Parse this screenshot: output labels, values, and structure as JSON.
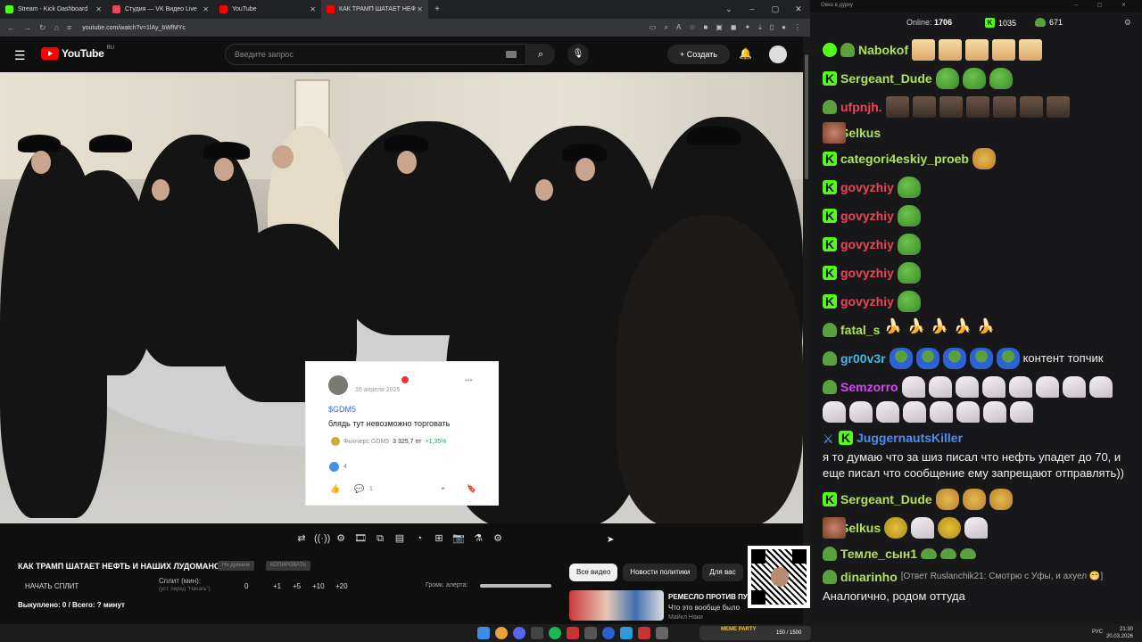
{
  "browser": {
    "tabs": [
      {
        "label": "Stream - Kick Dashboard",
        "color": "#53fc18"
      },
      {
        "label": "Студия — VK Видео Live",
        "color": "#e8465a"
      },
      {
        "label": "YouTube",
        "color": "#ff0000"
      },
      {
        "label": "КАК ТРАМП ШАТАЕТ НЕФ",
        "color": "#ff0000"
      }
    ],
    "url": "youtube.com/watch?v=1lAy_bWfMYc"
  },
  "youtube": {
    "logo": "YouTube",
    "region": "RU",
    "search_placeholder": "Введите запрос",
    "create_label": "Создать"
  },
  "card": {
    "date": "16 апреля 2025",
    "ticker": "$GDM5",
    "message": "блядь тут невозможно торговать",
    "futures_label": "Фьючерс GDM5",
    "futures_price": "3 325,7 пт",
    "futures_change": "+1,35%",
    "likes": "4",
    "comments": "1"
  },
  "below_video": {
    "title": "КАК ТРАМП ШАТАЕТ НЕФТЬ И НАШИХ ЛУДОМАНОВ",
    "pill1": "Не думаем",
    "pill2": "КОПИРОВАТЬ",
    "start_split": "НАЧАТЬ СПЛИТ",
    "split_label": "Сплит (мин):",
    "split_sub": "(уст. перед \"Начать\")",
    "split_value": "0",
    "inc": [
      "+1",
      "+5",
      "+10",
      "+20"
    ],
    "alert_label": "Громк. алерта:",
    "bought": "Выкуплено: 0 / Всего: ? минут",
    "chips": [
      "Все видео",
      "Новости политики",
      "Для вас"
    ],
    "reco_title": "РЕМЕСЛО ПРОТИВ ПУ",
    "reco_subtitle": "Что это вообще было",
    "reco_channel": "Майкл Наки"
  },
  "chat": {
    "window_title": "Окно в дурку",
    "online_label": "Online:",
    "online_count": "1706",
    "kick_count": "1035",
    "peepo_count": "671",
    "messages": [
      {
        "name": "Nabokof",
        "color": "#b2e05a"
      },
      {
        "name": "Sergeant_Dude",
        "color": "#b2e05a"
      },
      {
        "name": "ufpnjh.",
        "color": "#e8465a"
      },
      {
        "name": "Selkus",
        "color": "#b2e05a"
      },
      {
        "name": "categori4eskiy_proeb",
        "color": "#b2e05a"
      },
      {
        "name": "govyzhiy",
        "color": "#e8465a"
      },
      {
        "name": "govyzhiy",
        "color": "#e8465a"
      },
      {
        "name": "govyzhiy",
        "color": "#e8465a"
      },
      {
        "name": "govyzhiy",
        "color": "#e8465a"
      },
      {
        "name": "govyzhiy",
        "color": "#e8465a"
      },
      {
        "name": "fatal_s",
        "color": "#b2e05a"
      },
      {
        "name": "gr00v3r",
        "color": "#49b5e0",
        "text": "контент топчик"
      },
      {
        "name": "Semzorro",
        "color": "#d04cf0"
      },
      {
        "name": "JuggernautsKiller",
        "color": "#4b8cf0",
        "text": "я то думаю что за шиз писал что нефть упадет до 70, и еще писал что сообщение ему запрещают отправлять))"
      },
      {
        "name": "Sergeant_Dude",
        "color": "#b2e05a"
      },
      {
        "name": "Selkus",
        "color": "#b2e05a"
      },
      {
        "name": "Темле_сын1",
        "color": "#b2e05a"
      },
      {
        "name": "dinarinho",
        "color": "#b2e05a",
        "reply": "[Ответ Ruslanchik21: Смотрю с Уфы, и ахуел 😁]",
        "text": "Аналогично, родом оттуда"
      }
    ]
  },
  "taskbar": {
    "kick_label": "MEME PARTY",
    "kick_count": "150 / 1500",
    "lang": "РУС",
    "time": "21:30",
    "date": "20.03.2026"
  }
}
